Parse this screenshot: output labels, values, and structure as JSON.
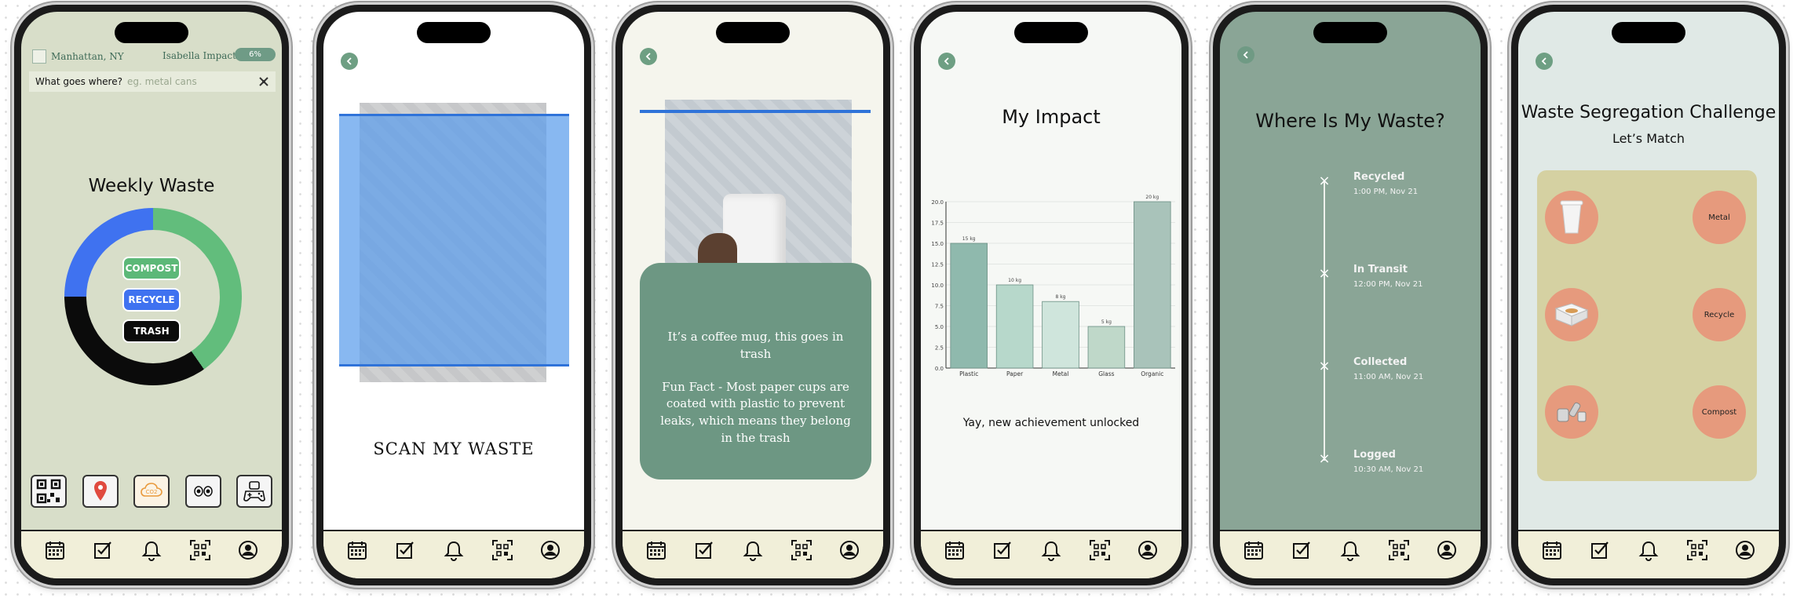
{
  "tabbar": [
    "calendar-icon",
    "checklist-icon",
    "bell-icon",
    "qr-scan-icon",
    "profile-icon"
  ],
  "screen1": {
    "location": "Manhattan, NY",
    "user": "Isabella Impact",
    "percent": "6%",
    "search_label": "What goes where?",
    "search_placeholder": "eg. metal cans",
    "title": "Weekly Waste",
    "donut": [
      {
        "name": "Compost",
        "color": "#62bd7c",
        "fraction": 0.4
      },
      {
        "name": "Trash",
        "color": "#0b0b0b",
        "fraction": 0.35
      },
      {
        "name": "Recycle",
        "color": "#3f72f0",
        "fraction": 0.25
      }
    ],
    "buttons": {
      "compost": "COMPOST",
      "recycle": "RECYCLE",
      "trash": "TRASH"
    },
    "quick_icons": [
      "qr-code-icon",
      "map-pin-icon",
      "co2-cloud-icon",
      "eyes-icon",
      "gamepad-icon"
    ]
  },
  "screen2": {
    "label": "SCAN MY WASTE"
  },
  "screen3": {
    "result": "It’s a coffee mug, this goes in trash",
    "fact": "Fun Fact - Most paper cups are coated with plastic to prevent leaks, which means they belong in the trash"
  },
  "screen4": {
    "title": "My Impact",
    "achievement": "Yay, new achievement unlocked",
    "chart_data": {
      "type": "bar",
      "title": "",
      "categories": [
        "Plastic",
        "Paper",
        "Metal",
        "Glass",
        "Organic"
      ],
      "values": [
        15,
        10,
        8,
        5,
        20
      ],
      "data_labels": [
        "15 kg",
        "10 kg",
        "8 kg",
        "5 kg",
        "20 kg"
      ],
      "colors": [
        "#8fb9ad",
        "#b7d8cb",
        "#cfe5dc",
        "#bfd8c9",
        "#a9c3ba"
      ],
      "ylim": [
        0,
        20
      ],
      "yticks": [
        "0.0",
        "2.5",
        "5.0",
        "7.5",
        "10.0",
        "12.5",
        "15.0",
        "17.5",
        "20.0"
      ],
      "grid": true
    }
  },
  "screen5": {
    "title": "Where Is My Waste?",
    "steps": [
      {
        "status": "Recycled",
        "time": "1:00 PM, Nov 21"
      },
      {
        "status": "In Transit",
        "time": "12:00 PM, Nov 21"
      },
      {
        "status": "Collected",
        "time": "11:00 AM, Nov 21"
      },
      {
        "status": "Logged",
        "time": "10:30 AM, Nov 21"
      }
    ]
  },
  "screen6": {
    "title": "Waste Segregation Challenge",
    "subtitle": "Let’s Match",
    "targets": [
      "Metal",
      "Recycle",
      "Compost"
    ],
    "items": [
      "paper-cup-icon",
      "food-container-icon",
      "cans-icon"
    ]
  }
}
